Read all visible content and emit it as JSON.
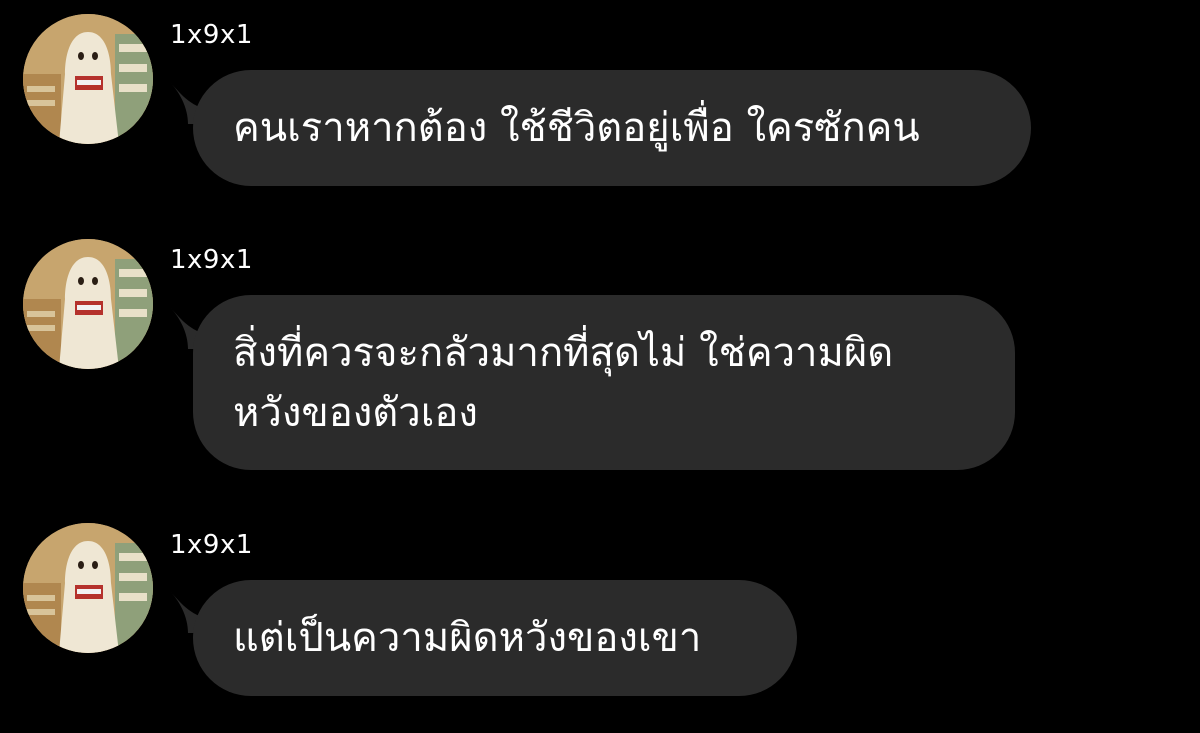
{
  "messages": [
    {
      "sender": "1x9x1",
      "lines": [
        "คนเราหากต้อง ใช้ชีวิตอยู่เพื่อ ใครซักคน"
      ]
    },
    {
      "sender": "1x9x1",
      "lines": [
        "สิ่งที่ควรจะกลัวมากที่สุดไม่ ใช่ความผิด",
        "หวังของตัวเอง"
      ]
    },
    {
      "sender": "1x9x1",
      "lines": [
        "แต่เป็นความผิดหวังของเขา"
      ]
    }
  ],
  "colors": {
    "background": "#000000",
    "bubble": "#2b2b2b",
    "text": "#ffffff"
  },
  "icons": {
    "avatar": "ghost-costume-photo-avatar"
  }
}
